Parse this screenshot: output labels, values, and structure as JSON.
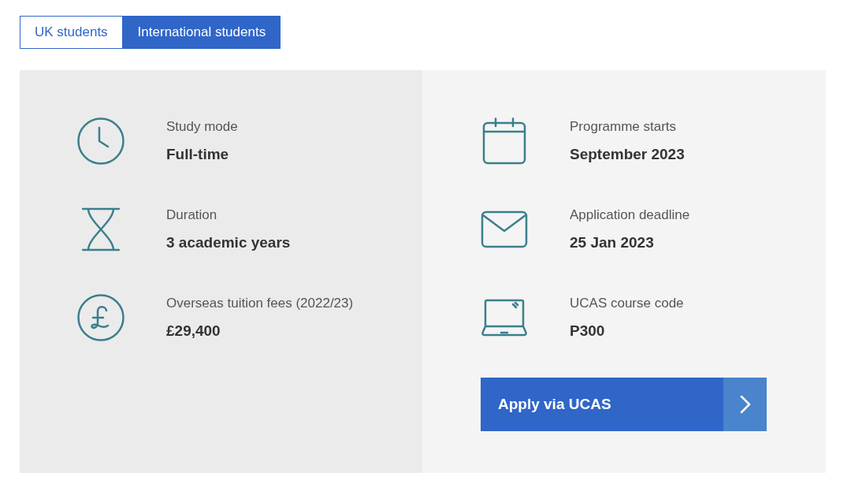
{
  "tabs": [
    {
      "label": "UK students",
      "selected": false
    },
    {
      "label": "International students",
      "selected": true
    }
  ],
  "details": {
    "left": [
      {
        "label": "Study mode",
        "value": "Full-time"
      },
      {
        "label": "Duration",
        "value": "3 academic years"
      },
      {
        "label": "Overseas tuition fees (2022/23)",
        "value": "£29,400"
      }
    ],
    "right": [
      {
        "label": "Programme starts",
        "value": "September 2023"
      },
      {
        "label": "Application deadline",
        "value": "25 Jan 2023"
      },
      {
        "label": "UCAS course code",
        "value": "P300"
      }
    ]
  },
  "apply_button": {
    "label": "Apply via UCAS"
  }
}
